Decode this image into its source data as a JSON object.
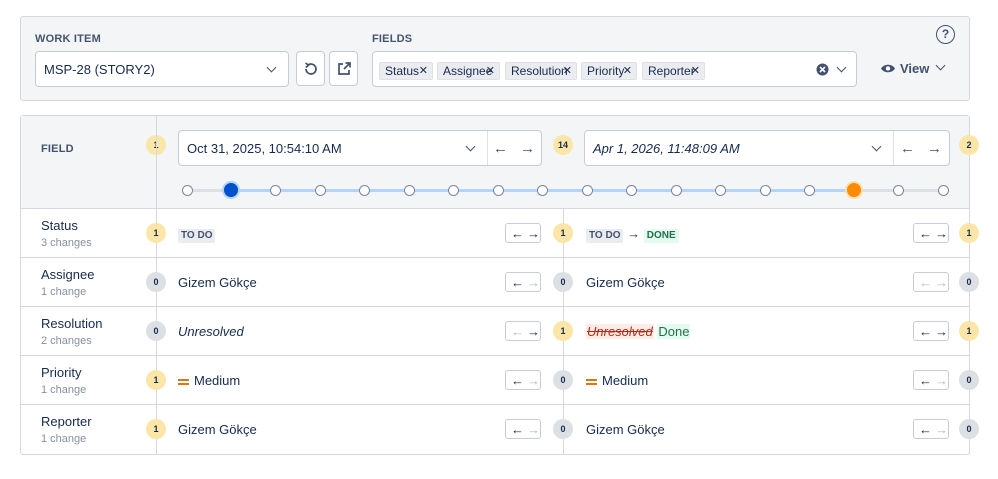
{
  "work_item": {
    "label": "WORK ITEM",
    "value": "MSP-28 (STORY2)"
  },
  "fields": {
    "label": "FIELDS",
    "tags": [
      "Status",
      "Assignee",
      "Resolution",
      "Priority",
      "Reporter"
    ]
  },
  "help": {
    "symbol": "?"
  },
  "view": {
    "label": "View"
  },
  "header": {
    "field_label": "FIELD",
    "left": {
      "index": "1",
      "date": "Oct 31, 2025, 10:54:10 AM"
    },
    "middle_count": "14",
    "right": {
      "index": "2",
      "date": "Apr 1, 2026, 11:48:09 AM"
    }
  },
  "timeline": {
    "total_points": 18,
    "left_selected": 2,
    "right_selected": 16,
    "colors": {
      "left": "#0052cc",
      "right": "#ff8b00"
    }
  },
  "rows": [
    {
      "name": "Status",
      "changes": "3 changes",
      "left_badge": "1",
      "left_value": "TO DO",
      "mid_badge": "1",
      "right_from": "TO DO",
      "right_to": "DONE",
      "right_badge": "1"
    },
    {
      "name": "Assignee",
      "changes": "1 change",
      "left_badge": "0",
      "left_value": "Gizem Gökçe",
      "mid_badge": "0",
      "right_value": "Gizem Gökçe",
      "right_badge": "0"
    },
    {
      "name": "Resolution",
      "changes": "2 changes",
      "left_badge": "0",
      "left_value": "Unresolved",
      "mid_badge": "1",
      "right_removed": "Unresolved",
      "right_added": "Done",
      "right_badge": "1"
    },
    {
      "name": "Priority",
      "changes": "1 change",
      "left_badge": "1",
      "left_value": "Medium",
      "mid_badge": "0",
      "right_value": "Medium",
      "right_badge": "0"
    },
    {
      "name": "Reporter",
      "changes": "1 change",
      "left_badge": "1",
      "left_value": "Gizem Gökçe",
      "mid_badge": "0",
      "right_value": "Gizem Gökçe",
      "right_badge": "0"
    }
  ],
  "arrows": {
    "prev": "←",
    "next": "→",
    "to": "→"
  }
}
